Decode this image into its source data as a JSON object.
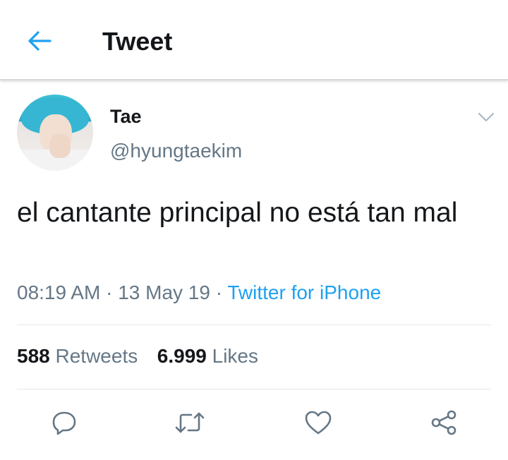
{
  "header": {
    "title": "Tweet",
    "back_icon": "arrow-left-icon",
    "accent": "#1da1f2"
  },
  "user": {
    "name": "Tae",
    "handle": "@hyungtaekim"
  },
  "tweet": {
    "text": "el cantante principal no está tan mal",
    "time": "08:19 AM",
    "sep1": " · ",
    "date": "13 May 19",
    "sep2": " · ",
    "source": "Twitter for iPhone"
  },
  "stats": {
    "retweets_count": "588",
    "retweets_label": "Retweets",
    "likes_count": "6.999",
    "likes_label": "Likes"
  },
  "actions": [
    "reply-icon",
    "retweet-icon",
    "like-icon",
    "share-icon"
  ],
  "colors": {
    "text": "#14171a",
    "secondary": "#657786",
    "link": "#1da1f2",
    "divider": "#e1e8ed"
  }
}
